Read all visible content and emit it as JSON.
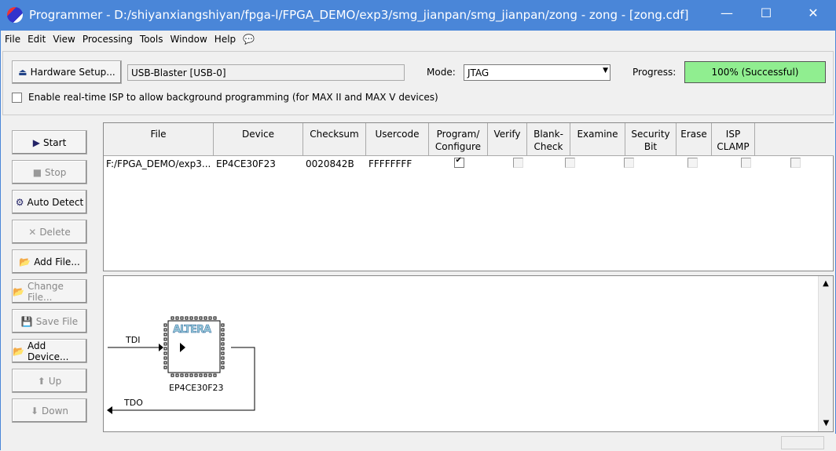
{
  "window": {
    "title": "Programmer - D:/shiyanxiangshiyan/fpga-l/FPGA_DEMO/exp3/smg_jianpan/smg_jianpan/zong - zong - [zong.cdf]",
    "minimize": "—",
    "maximize": "☐",
    "close": "✕"
  },
  "menu": [
    "File",
    "Edit",
    "View",
    "Processing",
    "Tools",
    "Window",
    "Help"
  ],
  "toolbar": {
    "hardware_setup": "Hardware Setup...",
    "hardware_value": "USB-Blaster [USB-0]",
    "mode_label": "Mode:",
    "mode_value": "JTAG",
    "progress_label": "Progress:",
    "progress_text": "100% (Successful)",
    "progress_percent": 100,
    "progress_color": "#90ee90",
    "isp_label": "Enable real-time ISP to allow background programming (for MAX II and MAX V devices)"
  },
  "buttons": [
    {
      "label": "Start",
      "enabled": true
    },
    {
      "label": "Stop",
      "enabled": false
    },
    {
      "label": "Auto Detect",
      "enabled": true
    },
    {
      "label": "Delete",
      "enabled": false
    },
    {
      "label": "Add File...",
      "enabled": true
    },
    {
      "label": "Change File...",
      "enabled": false
    },
    {
      "label": "Save File",
      "enabled": false
    },
    {
      "label": "Add Device...",
      "enabled": true
    },
    {
      "label": "Up",
      "enabled": false
    },
    {
      "label": "Down",
      "enabled": false
    }
  ],
  "table": {
    "columns": [
      "File",
      "Device",
      "Checksum",
      "Usercode",
      "Program/\nConfigure",
      "Verify",
      "Blank-\nCheck",
      "Examine",
      "Security\nBit",
      "Erase",
      "ISP\nCLAMP"
    ],
    "rows": [
      {
        "file": "F:/FPGA_DEMO/exp3...",
        "device": "EP4CE30F23",
        "checksum": "0020842B",
        "usercode": "FFFFFFFF",
        "checks": [
          true,
          false,
          false,
          false,
          false,
          false,
          false
        ]
      }
    ]
  },
  "diagram": {
    "tdi": "TDI",
    "tdo": "TDO",
    "chip_label": "EP4CE30F23",
    "logo": "ALTERA"
  }
}
